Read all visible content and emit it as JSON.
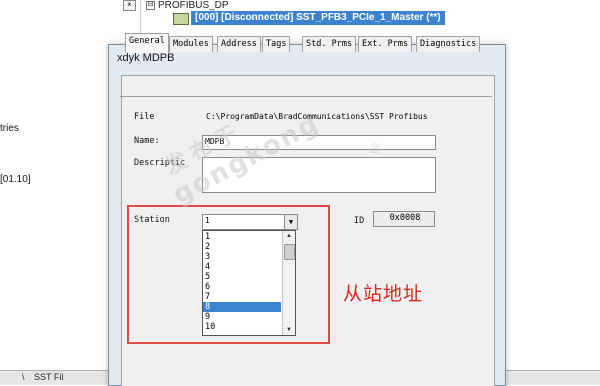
{
  "background": {
    "left_fragments": [
      "tries",
      "[01.10]"
    ],
    "tree_root": {
      "toggle": "⊟",
      "label": "PROFIBUS_DP"
    },
    "tree_child": {
      "label": "[000] [Disconnected] SST_PFB3_PCIe_1_Master (**)"
    },
    "bottom_text": [
      "\\",
      "SST Fil"
    ]
  },
  "dialog": {
    "title": "xdyk MDPB",
    "tabs": [
      "General",
      "Modules",
      "Address",
      "Tags",
      "Std. Prms",
      "Ext. Prms",
      "Diagnostics"
    ],
    "active_tab": "General",
    "fields": {
      "file_label": "File",
      "file_value": "C:\\ProgramData\\BradCommunications\\SST Profibus",
      "name_label": "Name:",
      "name_value": "MDPB",
      "description_label": "Descriptic",
      "description_value": "",
      "station_label": "Station",
      "station_value": "1",
      "id_label": "ID",
      "id_value": "0x0008"
    },
    "station_options": [
      "1",
      "2",
      "3",
      "4",
      "5",
      "6",
      "7",
      "8",
      "9",
      "10"
    ],
    "selected_option": "8"
  },
  "annotation": {
    "text": "从站地址",
    "color": "#e0261e"
  },
  "watermark": {
    "line1": "发布于",
    "line2": "gongkong",
    "mark": "®"
  },
  "colors": {
    "selection": "#3b83d0",
    "highlight_box": "#e24a4a"
  }
}
